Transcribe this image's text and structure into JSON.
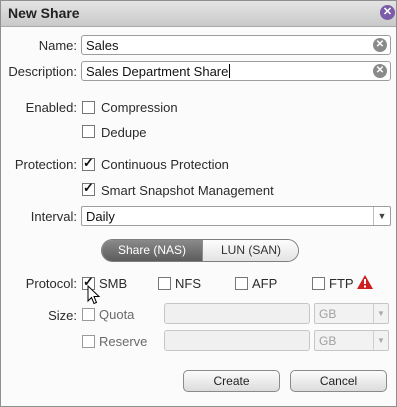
{
  "dialog": {
    "title": "New Share",
    "close_icon": "close-icon"
  },
  "form": {
    "name_label": "Name:",
    "name_value": "Sales",
    "description_label": "Description:",
    "description_value": "Sales Department Share",
    "enabled_label": "Enabled:",
    "compression_label": "Compression",
    "compression_checked": false,
    "dedupe_label": "Dedupe",
    "dedupe_checked": false,
    "protection_label": "Protection:",
    "continuous_label": "Continuous Protection",
    "continuous_checked": true,
    "snapshot_label": "Smart Snapshot Management",
    "snapshot_checked": true,
    "interval_label": "Interval:",
    "interval_value": "Daily",
    "share_type": {
      "nas_label": "Share (NAS)",
      "san_label": "LUN (SAN)",
      "selected": "Share (NAS)"
    },
    "protocol_label": "Protocol:",
    "protocols": [
      {
        "label": "SMB",
        "checked": true
      },
      {
        "label": "NFS",
        "checked": false
      },
      {
        "label": "AFP",
        "checked": false
      },
      {
        "label": "FTP",
        "checked": false
      }
    ],
    "warning_icon": "warning-icon",
    "warning_color": "#cc1f1f",
    "size_label": "Size:",
    "quota_label": "Quota",
    "quota_unit": "GB",
    "reserve_label": "Reserve",
    "reserve_unit": "GB"
  },
  "buttons": {
    "create_label": "Create",
    "cancel_label": "Cancel"
  },
  "colors": {
    "close_button": "#7a5ca8",
    "selected_segment": "#6e6e6e"
  }
}
